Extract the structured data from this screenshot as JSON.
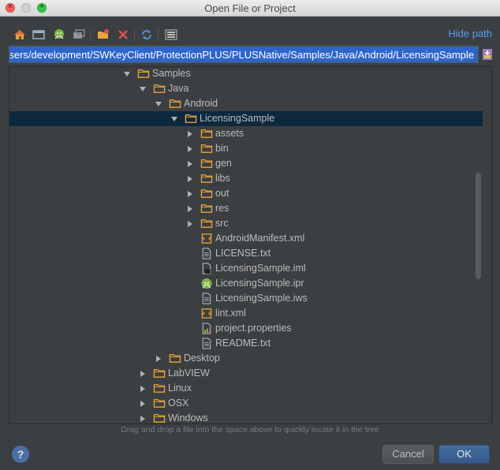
{
  "window": {
    "title": "Open File or Project"
  },
  "toolbar": {
    "buttons": [
      {
        "icon": "home-icon"
      },
      {
        "icon": "desktop-icon"
      },
      {
        "icon": "android-project-icon"
      },
      {
        "icon": "module-icon"
      },
      {
        "icon": "new-folder-icon"
      },
      {
        "icon": "delete-icon"
      },
      {
        "icon": "refresh-icon"
      },
      {
        "icon": "show-hidden-icon"
      }
    ],
    "hide_path_label": "Hide path"
  },
  "path": {
    "value": "/Users/development/SWKeyClient/ProtectionPLUS/PLUSNative/Samples/Java/Android/LicensingSample",
    "visible": "velopment/SWKeyClient/ProtectionPLUS/PLUSNative/Samples/Java/Android/LicensingSample"
  },
  "tree": {
    "rows": [
      {
        "label": "Samples",
        "type": "folder",
        "state": "expanded",
        "depth": 0
      },
      {
        "label": "Java",
        "type": "folder",
        "state": "expanded",
        "depth": 1
      },
      {
        "label": "Android",
        "type": "folder",
        "state": "expanded",
        "depth": 2
      },
      {
        "label": "LicensingSample",
        "type": "folder",
        "state": "expanded",
        "depth": 3,
        "selected": true
      },
      {
        "label": "assets",
        "type": "folder",
        "state": "collapsed",
        "depth": 4
      },
      {
        "label": "bin",
        "type": "folder",
        "state": "collapsed",
        "depth": 4
      },
      {
        "label": "gen",
        "type": "folder",
        "state": "collapsed",
        "depth": 4
      },
      {
        "label": "libs",
        "type": "folder",
        "state": "collapsed",
        "depth": 4
      },
      {
        "label": "out",
        "type": "folder",
        "state": "collapsed",
        "depth": 4
      },
      {
        "label": "res",
        "type": "folder",
        "state": "collapsed",
        "depth": 4
      },
      {
        "label": "src",
        "type": "folder",
        "state": "collapsed",
        "depth": 4
      },
      {
        "label": "AndroidManifest.xml",
        "type": "xml",
        "depth": 4
      },
      {
        "label": "LICENSE.txt",
        "type": "text",
        "depth": 4
      },
      {
        "label": "LicensingSample.iml",
        "type": "iml",
        "depth": 4
      },
      {
        "label": "LicensingSample.ipr",
        "type": "ipr",
        "depth": 4
      },
      {
        "label": "LicensingSample.iws",
        "type": "text",
        "depth": 4
      },
      {
        "label": "lint.xml",
        "type": "xml",
        "depth": 4
      },
      {
        "label": "project.properties",
        "type": "properties",
        "depth": 4
      },
      {
        "label": "README.txt",
        "type": "text",
        "depth": 4
      },
      {
        "label": "Desktop",
        "type": "folder",
        "state": "collapsed",
        "depth": 2
      },
      {
        "label": "LabVIEW",
        "type": "folder",
        "state": "collapsed",
        "depth": 1
      },
      {
        "label": "Linux",
        "type": "folder",
        "state": "collapsed",
        "depth": 1
      },
      {
        "label": "OSX",
        "type": "folder",
        "state": "collapsed",
        "depth": 1
      },
      {
        "label": "Windows",
        "type": "folder",
        "state": "collapsed",
        "depth": 1
      }
    ]
  },
  "hint": "Drag and drop a file into the space above to quickly locate it in the tree",
  "buttons": {
    "cancel": "Cancel",
    "ok": "OK",
    "help": "?"
  },
  "colors": {
    "accent": "#589df6",
    "selection": "#0d293e",
    "folder": "#e8a33d",
    "background": "#3c3f41"
  }
}
